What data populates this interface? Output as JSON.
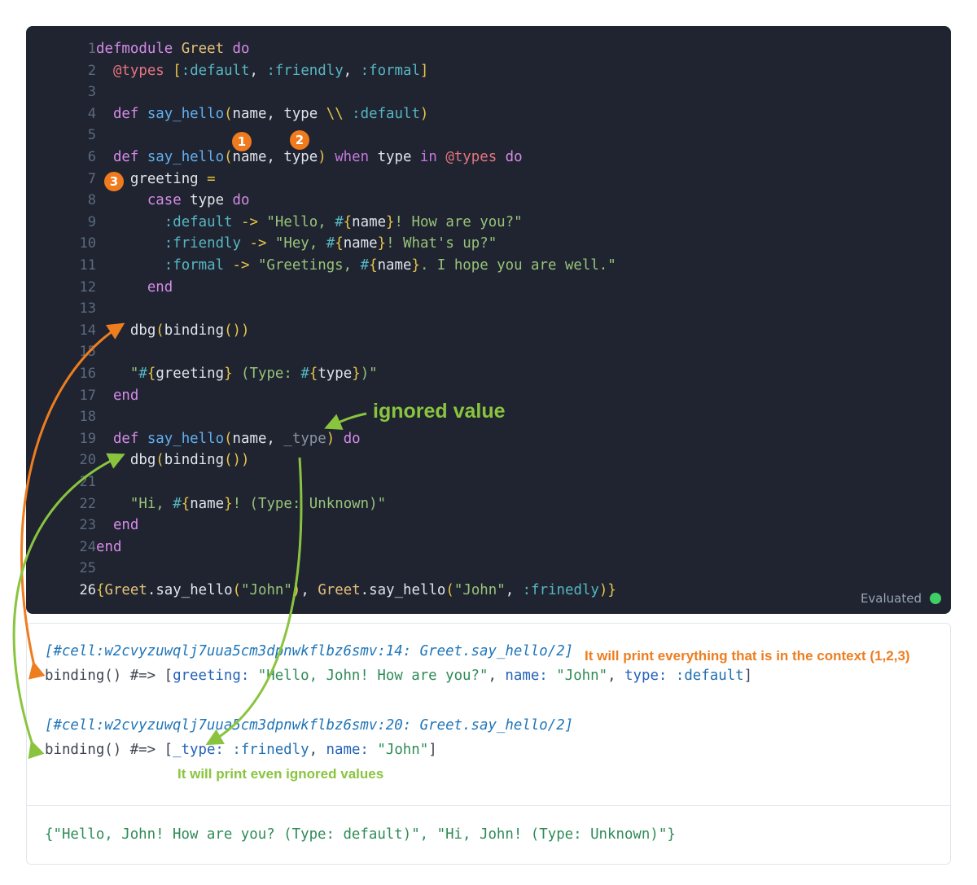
{
  "editor": {
    "lines": [
      {
        "n": "1",
        "tokens": [
          [
            "d",
            "defmodule "
          ],
          [
            "m",
            "Greet"
          ],
          [
            "d",
            " do"
          ]
        ]
      },
      {
        "n": "2",
        "tokens": [
          [
            "at",
            "  @types "
          ],
          [
            "p",
            "["
          ],
          [
            "o",
            ":default"
          ],
          [
            "v",
            ", "
          ],
          [
            "o",
            ":friendly"
          ],
          [
            "v",
            ", "
          ],
          [
            "o",
            ":formal"
          ],
          [
            "p",
            "]"
          ]
        ]
      },
      {
        "n": "3",
        "tokens": []
      },
      {
        "n": "4",
        "tokens": [
          [
            "d",
            "  def "
          ],
          [
            "f",
            "say_hello"
          ],
          [
            "p",
            "("
          ],
          [
            "v",
            "name, type "
          ],
          [
            "p",
            "\\\\"
          ],
          [
            "v",
            " "
          ],
          [
            "o",
            ":default"
          ],
          [
            "p",
            ")"
          ]
        ]
      },
      {
        "n": "5",
        "tokens": []
      },
      {
        "n": "6",
        "tokens": [
          [
            "d",
            "  def "
          ],
          [
            "f",
            "say_hello"
          ],
          [
            "p",
            "("
          ],
          [
            "v",
            "name, type"
          ],
          [
            "p",
            ")"
          ],
          [
            "k",
            " when "
          ],
          [
            "v",
            "type "
          ],
          [
            "k",
            "in "
          ],
          [
            "at",
            "@types"
          ],
          [
            "d",
            " do"
          ]
        ]
      },
      {
        "n": "7",
        "tokens": [
          [
            "v",
            "    greeting "
          ],
          [
            "p",
            "="
          ]
        ]
      },
      {
        "n": "8",
        "tokens": [
          [
            "d",
            "      case "
          ],
          [
            "v",
            "type "
          ],
          [
            "d",
            "do"
          ]
        ]
      },
      {
        "n": "9",
        "tokens": [
          [
            "o",
            "        :default"
          ],
          [
            "p",
            " -> "
          ],
          [
            "s",
            "\"Hello, "
          ],
          [
            "o",
            "#"
          ],
          [
            "p",
            "{"
          ],
          [
            "v",
            "name"
          ],
          [
            "p",
            "}"
          ],
          [
            "s",
            "! How are you?\""
          ]
        ]
      },
      {
        "n": "10",
        "tokens": [
          [
            "o",
            "        :friendly"
          ],
          [
            "p",
            " -> "
          ],
          [
            "s",
            "\"Hey, "
          ],
          [
            "o",
            "#"
          ],
          [
            "p",
            "{"
          ],
          [
            "v",
            "name"
          ],
          [
            "p",
            "}"
          ],
          [
            "s",
            "! What's up?\""
          ]
        ]
      },
      {
        "n": "11",
        "tokens": [
          [
            "o",
            "        :formal"
          ],
          [
            "p",
            " -> "
          ],
          [
            "s",
            "\"Greetings, "
          ],
          [
            "o",
            "#"
          ],
          [
            "p",
            "{"
          ],
          [
            "v",
            "name"
          ],
          [
            "p",
            "}"
          ],
          [
            "s",
            ". I hope you are well.\""
          ]
        ]
      },
      {
        "n": "12",
        "tokens": [
          [
            "d",
            "      end"
          ]
        ]
      },
      {
        "n": "13",
        "tokens": []
      },
      {
        "n": "14",
        "tokens": [
          [
            "v",
            "    dbg"
          ],
          [
            "p",
            "("
          ],
          [
            "v",
            "binding"
          ],
          [
            "p",
            "()"
          ],
          [
            "p",
            ")"
          ]
        ]
      },
      {
        "n": "15",
        "tokens": []
      },
      {
        "n": "16",
        "tokens": [
          [
            "s",
            "    \""
          ],
          [
            "o",
            "#"
          ],
          [
            "p",
            "{"
          ],
          [
            "v",
            "greeting"
          ],
          [
            "p",
            "}"
          ],
          [
            "s",
            " (Type: "
          ],
          [
            "o",
            "#"
          ],
          [
            "p",
            "{"
          ],
          [
            "v",
            "type"
          ],
          [
            "p",
            "}"
          ],
          [
            "s",
            ")\""
          ]
        ]
      },
      {
        "n": "17",
        "tokens": [
          [
            "d",
            "  end"
          ]
        ]
      },
      {
        "n": "18",
        "tokens": []
      },
      {
        "n": "19",
        "tokens": [
          [
            "d",
            "  def "
          ],
          [
            "f",
            "say_hello"
          ],
          [
            "p",
            "("
          ],
          [
            "v",
            "name, "
          ],
          [
            "c",
            "_type"
          ],
          [
            "p",
            ")"
          ],
          [
            "d",
            " do"
          ]
        ]
      },
      {
        "n": "20",
        "tokens": [
          [
            "v",
            "    dbg"
          ],
          [
            "p",
            "("
          ],
          [
            "v",
            "binding"
          ],
          [
            "p",
            "()"
          ],
          [
            "p",
            ")"
          ]
        ]
      },
      {
        "n": "21",
        "tokens": []
      },
      {
        "n": "22",
        "tokens": [
          [
            "s",
            "    \"Hi, "
          ],
          [
            "o",
            "#"
          ],
          [
            "p",
            "{"
          ],
          [
            "v",
            "name"
          ],
          [
            "p",
            "}"
          ],
          [
            "s",
            "! (Type: Unknown)\""
          ]
        ]
      },
      {
        "n": "23",
        "tokens": [
          [
            "d",
            "  end"
          ]
        ]
      },
      {
        "n": "24",
        "tokens": [
          [
            "d",
            "end"
          ]
        ]
      },
      {
        "n": "25",
        "tokens": []
      },
      {
        "n": "26",
        "tokens": [
          [
            "p",
            "{"
          ],
          [
            "m",
            "Greet"
          ],
          [
            "v",
            "."
          ],
          [
            "v",
            "say_hello"
          ],
          [
            "p",
            "("
          ],
          [
            "s",
            "\"John\""
          ],
          [
            "p",
            ")"
          ],
          [
            "v",
            ", "
          ],
          [
            "m",
            "Greet"
          ],
          [
            "v",
            "."
          ],
          [
            "v",
            "say_hello"
          ],
          [
            "p",
            "("
          ],
          [
            "s",
            "\"John\""
          ],
          [
            "v",
            ", "
          ],
          [
            "o",
            ":frinedly"
          ],
          [
            "p",
            ")}"
          ]
        ]
      }
    ],
    "active_line": "26",
    "status_label": "Evaluated"
  },
  "badges": [
    "1",
    "2",
    "3"
  ],
  "output": {
    "block1_location": "[#cell:w2cvyzuwqlj7uua5cm3dpnwkflbz6smv:14: Greet.say_hello/2]",
    "block1_tokens": [
      [
        "plain",
        "binding() #=> ["
      ],
      [
        "key",
        "greeting: "
      ],
      [
        "str",
        "\"Hello, John! How are you?\""
      ],
      [
        "plain",
        ", "
      ],
      [
        "key",
        "name: "
      ],
      [
        "str",
        "\"John\""
      ],
      [
        "plain",
        ", "
      ],
      [
        "key",
        "type: "
      ],
      [
        "atom",
        ":default"
      ],
      [
        "plain",
        "]"
      ]
    ],
    "block2_location": "[#cell:w2cvyzuwqlj7uua5cm3dpnwkflbz6smv:20: Greet.say_hello/2]",
    "block2_tokens": [
      [
        "plain",
        "binding() #=> ["
      ],
      [
        "key",
        "_type: "
      ],
      [
        "atom",
        ":frinedly"
      ],
      [
        "plain",
        ", "
      ],
      [
        "key",
        "name: "
      ],
      [
        "str",
        "\"John\""
      ],
      [
        "plain",
        "]"
      ]
    ],
    "result": "{\"Hello, John! How are you? (Type: default)\", \"Hi, John! (Type: Unknown)\"}"
  },
  "annotations": {
    "ignored_value": "ignored value",
    "print_context": "It will print everything that is in the context (1,2,3)",
    "print_ignored": "It will print even ignored values"
  },
  "colors": {
    "editor_bg": "#1f2430",
    "annotation_orange": "#ee7d1f",
    "annotation_green": "#8ac43f",
    "status_green": "#3ecf65"
  }
}
